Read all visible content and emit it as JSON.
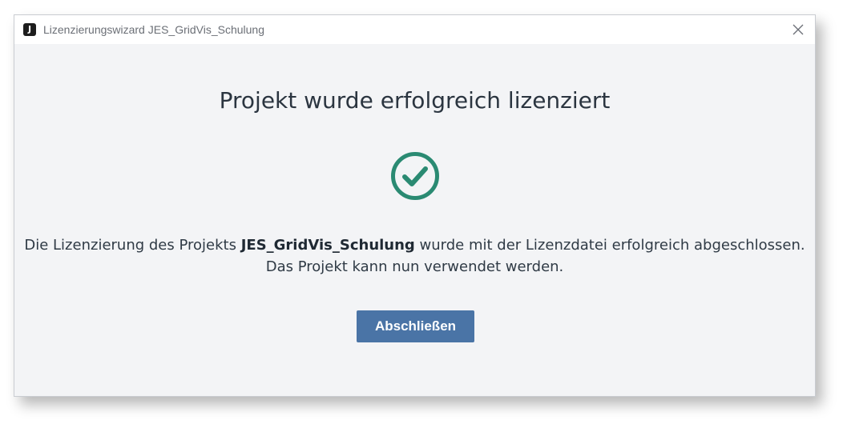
{
  "window": {
    "title": "Lizenzierungswizard JES_GridVis_Schulung",
    "app_icon_glyph": "J",
    "app_icon": "app-logo-icon",
    "close_icon": "close-icon"
  },
  "content": {
    "heading": "Projekt wurde erfolgreich lizenziert",
    "status_icon": "check-circle-icon",
    "status_color": "#2a8a72",
    "message_prefix": "Die Lizenzierung des Projekts ",
    "project_name": "JES_GridVis_Schulung",
    "message_suffix": " wurde mit der Lizenzdatei erfolgreich abgeschlossen.",
    "message_line2": "Das Projekt kann nun verwendet werden."
  },
  "actions": {
    "finish_label": "Abschließen",
    "button_color": "#4a74a6"
  }
}
